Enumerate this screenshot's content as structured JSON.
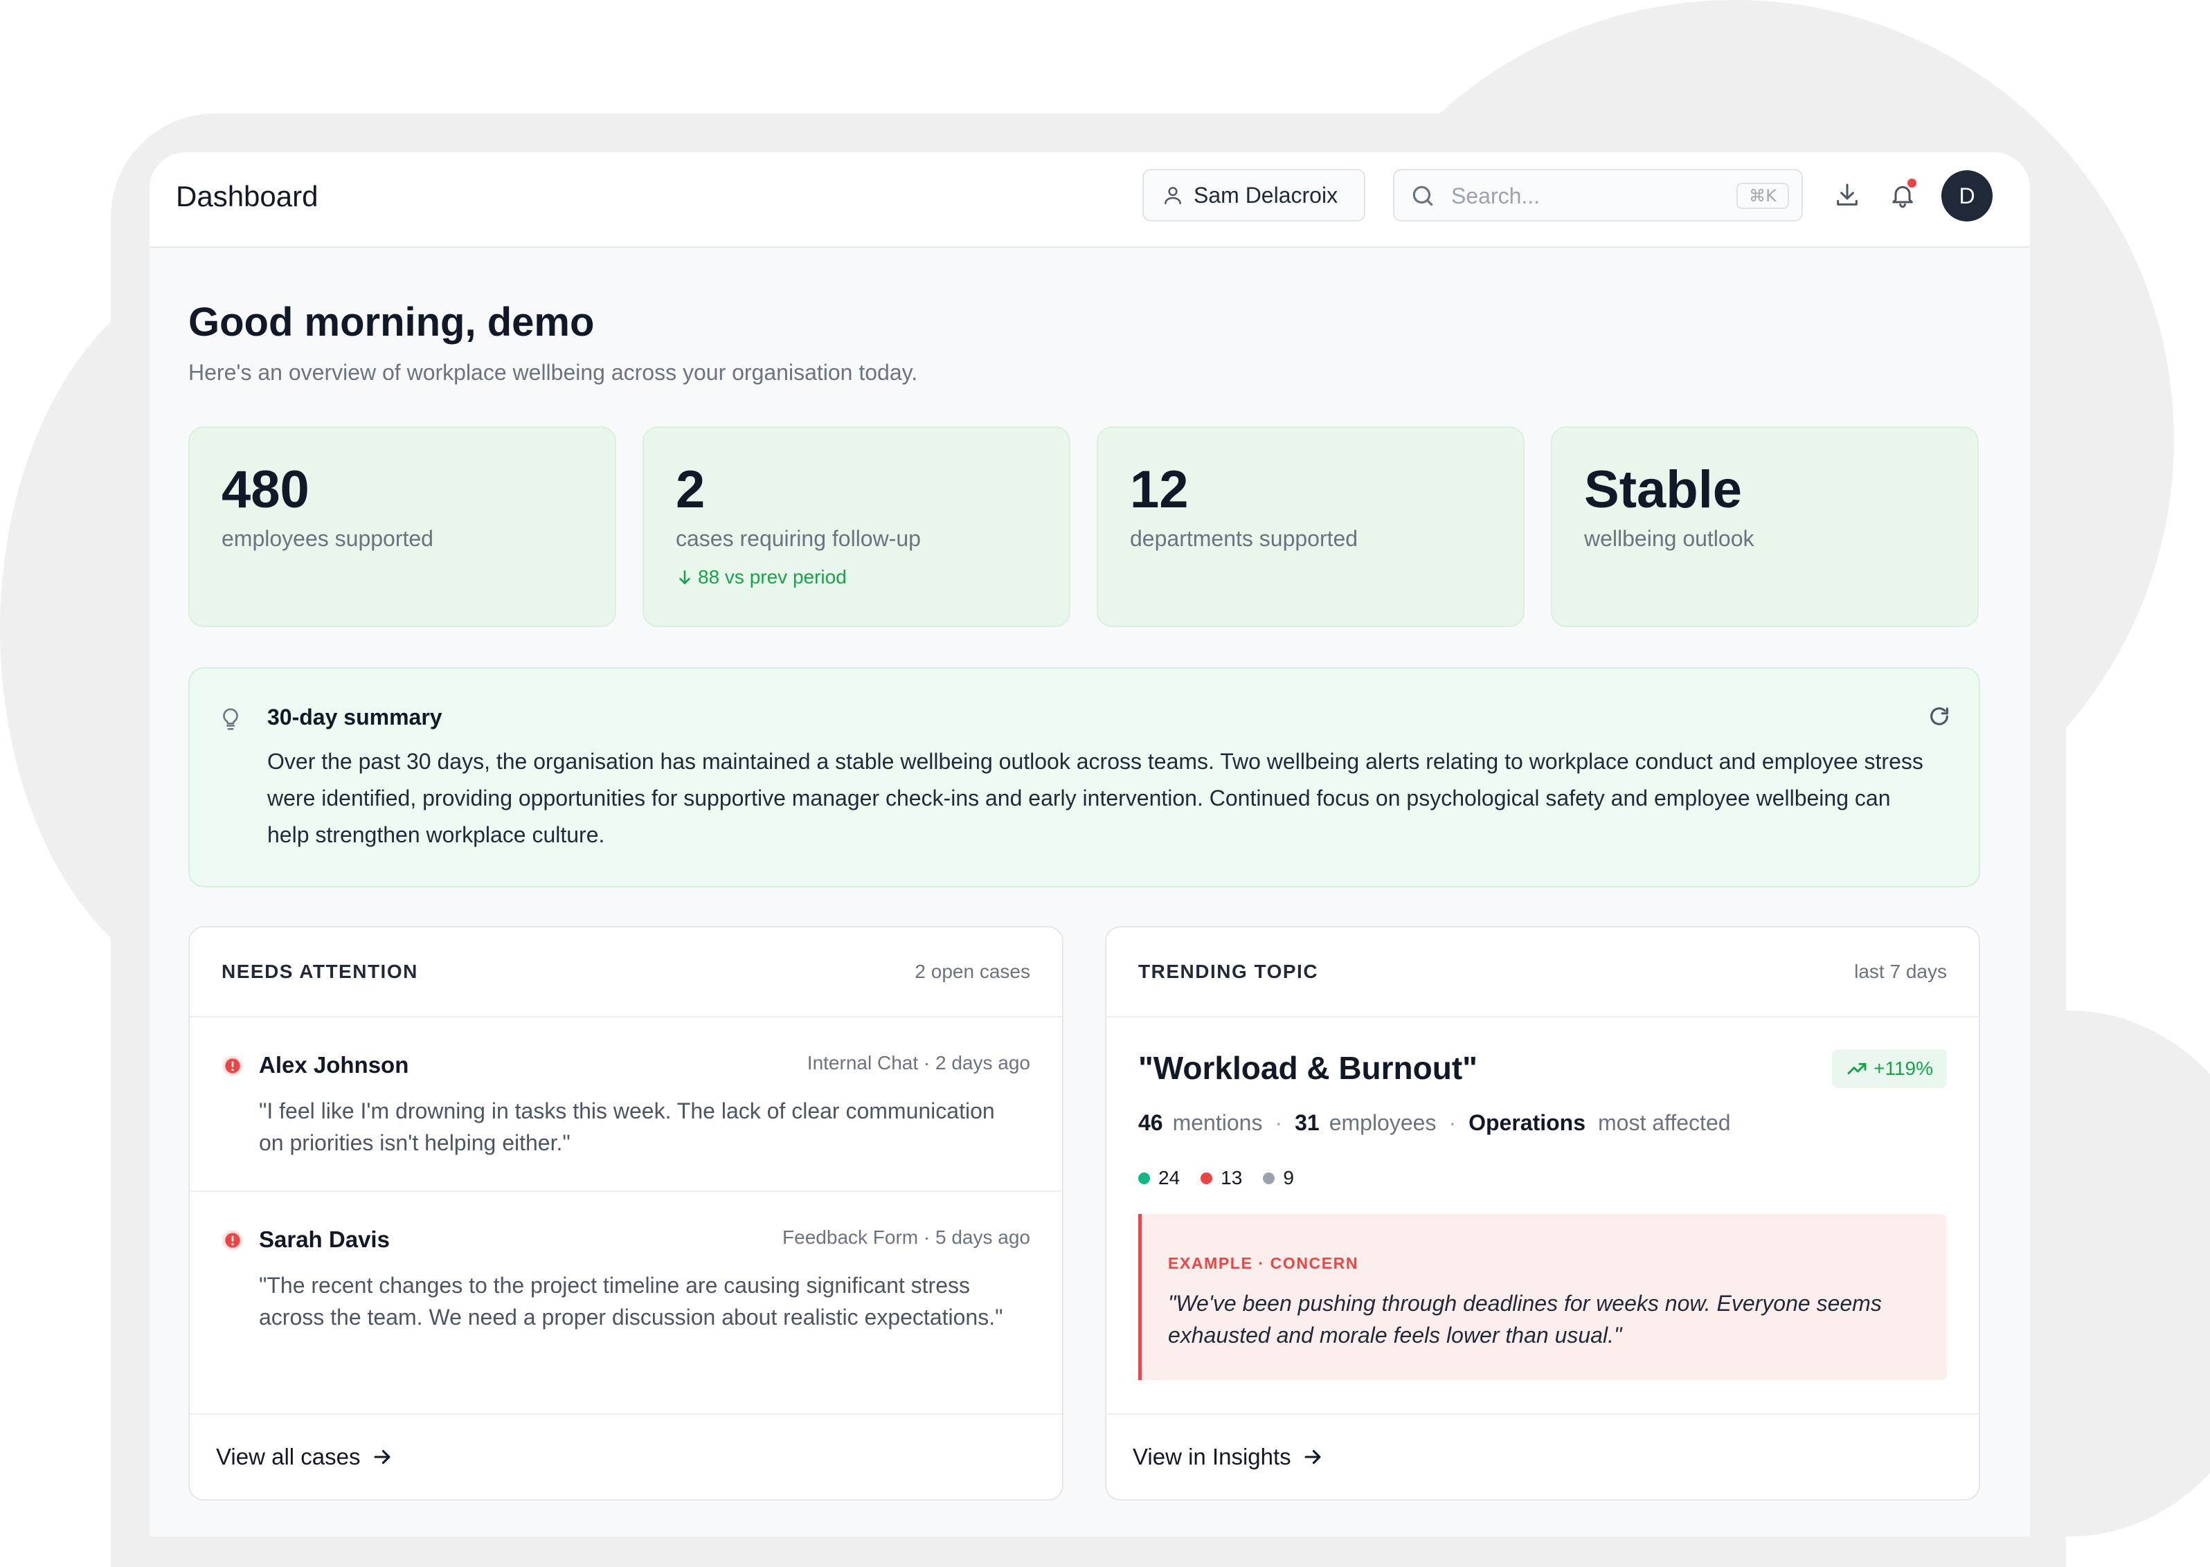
{
  "header": {
    "title": "Dashboard",
    "user": "Sam Delacroix",
    "search_placeholder": "Search...",
    "search_shortcut": "⌘K",
    "avatar_initial": "D",
    "notification_dot_color": "#ef4444"
  },
  "greeting": {
    "title": "Good morning, demo",
    "subtitle": "Here's an overview of workplace wellbeing across your organisation today."
  },
  "stats": [
    {
      "value": "480",
      "label": "employees supported"
    },
    {
      "value": "2",
      "label": "cases requiring follow-up",
      "trend": "88 vs prev period"
    },
    {
      "value": "12",
      "label": "departments supported"
    },
    {
      "value": "Stable",
      "label": "wellbeing outlook"
    }
  ],
  "summary": {
    "title": "30-day summary",
    "text": "Over the past 30 days, the organisation has maintained a stable wellbeing outlook across teams. Two wellbeing alerts relating to workplace conduct and employee stress were identified, providing opportunities for supportive manager check-ins and early intervention. Continued focus on psychological safety and employee wellbeing can help strengthen workplace culture."
  },
  "attention": {
    "title": "NEEDS ATTENTION",
    "meta": "2 open cases",
    "cases": [
      {
        "name": "Alex Johnson",
        "source": "Internal Chat · 2 days ago",
        "quote": "\"I feel like I'm drowning in tasks this week. The lack of clear communication on priorities isn't helping either.\""
      },
      {
        "name": "Sarah Davis",
        "source": "Feedback Form · 5 days ago",
        "quote": "\"The recent changes to the project timeline are causing significant stress across the team. We need a proper discussion about realistic expectations.\""
      }
    ],
    "footer_link": "View all cases"
  },
  "trending": {
    "title": "TRENDING TOPIC",
    "meta": "last 7 days",
    "topic": "\"Workload & Burnout\"",
    "change": "+119%",
    "mentions": "46",
    "mentions_label": "mentions",
    "employees": "31",
    "employees_label": "employees",
    "department": "Operations",
    "department_label": "most affected",
    "sentiment": [
      {
        "count": "24",
        "color": "#10b981"
      },
      {
        "count": "13",
        "color": "#ef4444"
      },
      {
        "count": "9",
        "color": "#9ca3af"
      }
    ],
    "example_label": "EXAMPLE · CONCERN",
    "example_quote": "\"We've been pushing through deadlines for weeks now. Everyone seems exhausted and morale feels lower than usual.\"",
    "footer_link": "View in Insights"
  },
  "colors": {
    "stat_card_bg": "#e9f6ec",
    "summary_bg": "#ecfaf1",
    "positive": "#16a34a",
    "alert": "#ef4444",
    "text_primary": "#111827",
    "text_muted": "#6b7280"
  }
}
